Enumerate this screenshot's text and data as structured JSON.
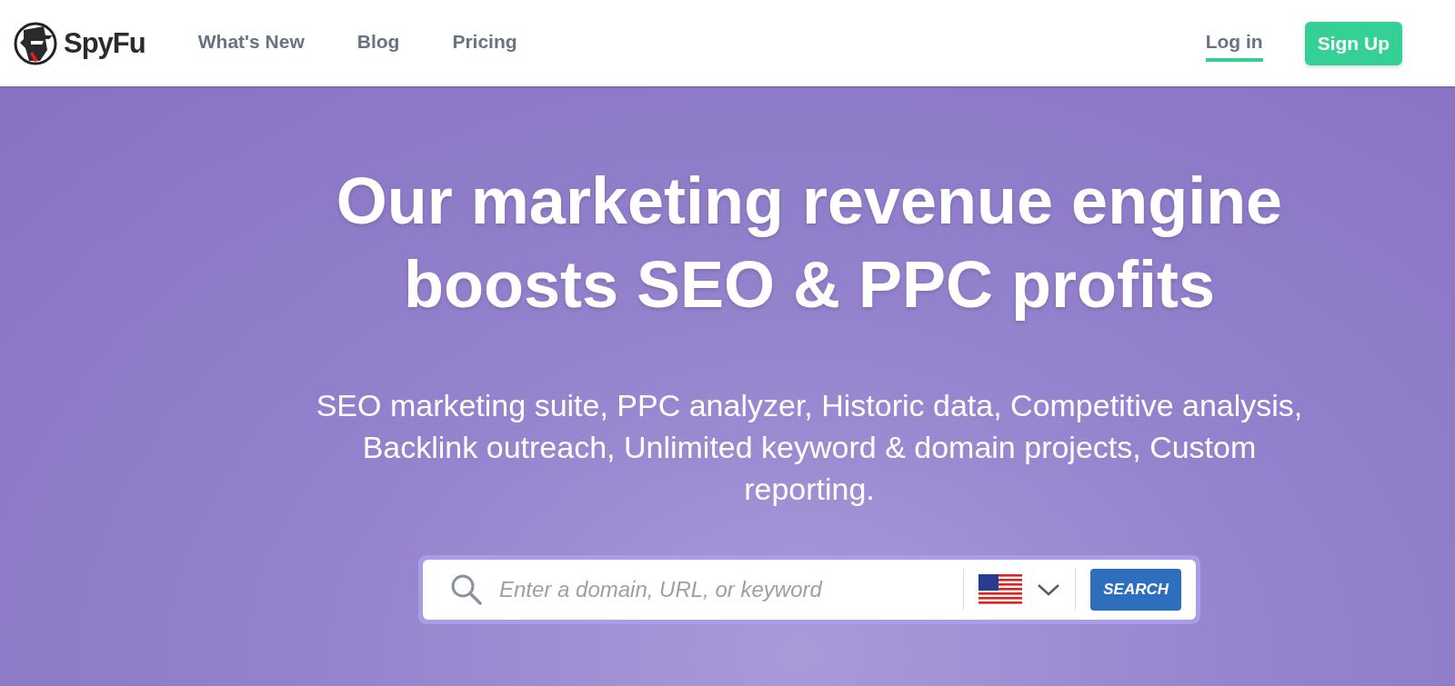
{
  "header": {
    "brand": "SpyFu",
    "links": [
      {
        "label": "What's New"
      },
      {
        "label": "Blog"
      },
      {
        "label": "Pricing"
      }
    ],
    "login": {
      "label": "Log in",
      "underlined": true
    },
    "signup": {
      "label": "Sign Up"
    }
  },
  "hero": {
    "headline": "Our marketing revenue engine boosts SEO & PPC profits",
    "subtitle": "SEO marketing suite, PPC analyzer, Historic data, Competitive analysis, Backlink outreach, Unlimited keyword & domain projects, Custom reporting.",
    "search": {
      "placeholder": "Enter a domain, URL, or keyword",
      "button": "SEARCH"
    }
  }
}
